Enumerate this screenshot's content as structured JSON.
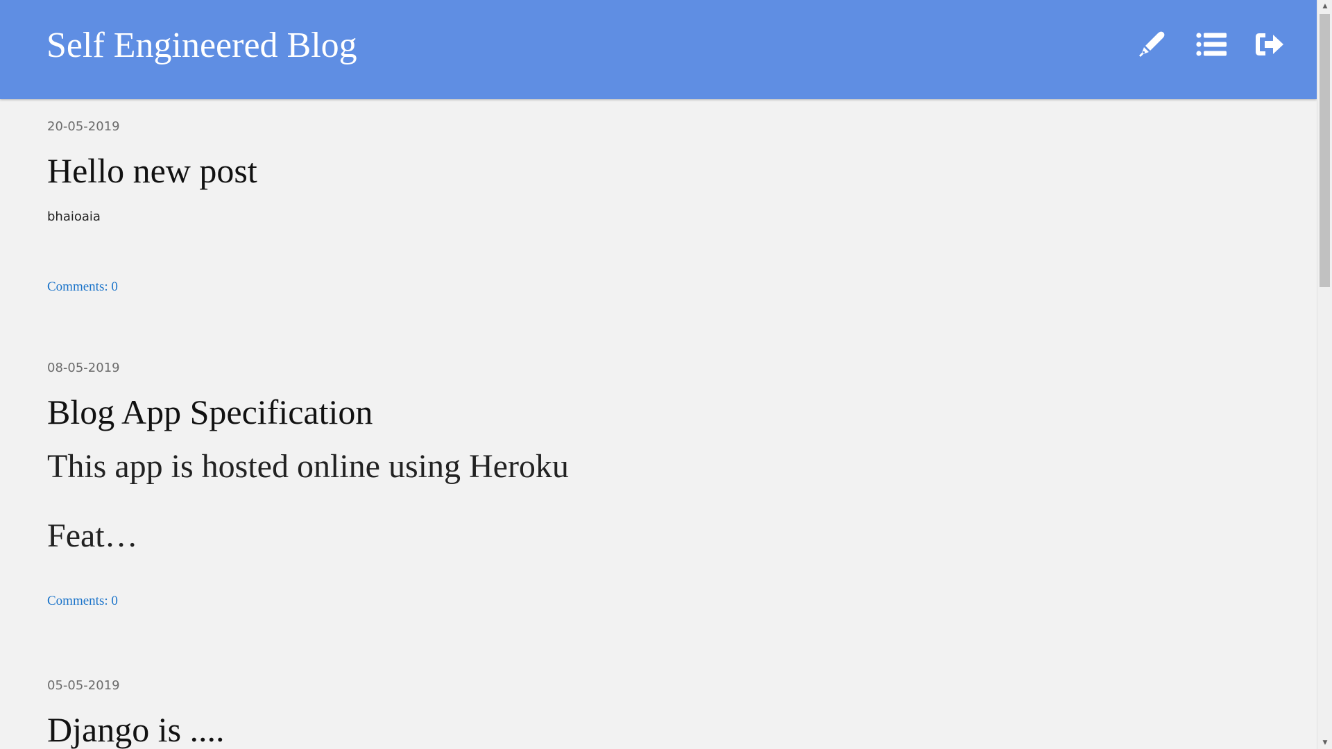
{
  "header": {
    "brand": "Self Engineered Blog",
    "background_color": "#5f8ee3",
    "icons": [
      "pen-icon",
      "list-icon",
      "logout-icon"
    ]
  },
  "posts": [
    {
      "date": "20-05-2019",
      "title": "Hello new post",
      "excerpt": [
        "bhaioaia"
      ],
      "comments": "Comments: 0"
    },
    {
      "date": "08-05-2019",
      "title": "Blog App Specification",
      "excerpt": [
        "This app is hosted online using Heroku",
        "Feat…"
      ],
      "comments": "Comments: 0"
    },
    {
      "date": "05-05-2019",
      "title": "Django is ...."
    }
  ],
  "colors": {
    "page_background": "#f2f2f2",
    "link": "#1a73c9"
  }
}
